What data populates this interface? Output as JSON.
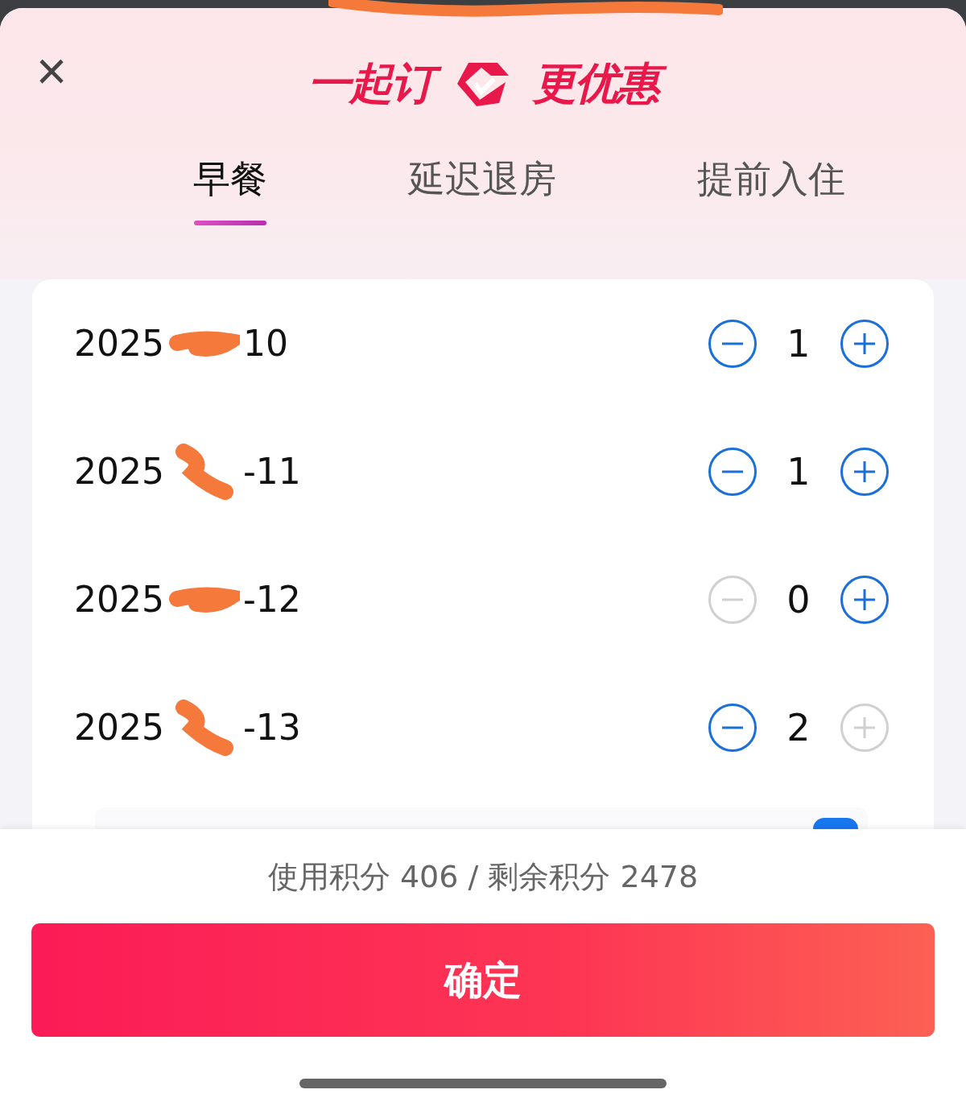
{
  "header": {
    "close": "×",
    "logo_left": "一起订",
    "logo_right": "更优惠"
  },
  "tabs": [
    {
      "label": "早餐",
      "selected": true
    },
    {
      "label": "延迟退房",
      "selected": false
    },
    {
      "label": "提前入住",
      "selected": false
    }
  ],
  "rows": [
    {
      "date_start": "2025",
      "date_end": "10",
      "count": "1",
      "minus_disabled": false,
      "plus_disabled": false
    },
    {
      "date_start": "2025",
      "date_end": "-11",
      "count": "1",
      "minus_disabled": false,
      "plus_disabled": false
    },
    {
      "date_start": "2025",
      "date_end": "-12",
      "count": "0",
      "minus_disabled": true,
      "plus_disabled": false
    },
    {
      "date_start": "2025",
      "date_end": "-13",
      "count": "2",
      "minus_disabled": false,
      "plus_disabled": true
    }
  ],
  "footer": {
    "points": "使用积分 406 / 剩余积分 2478",
    "confirm": "确定"
  }
}
